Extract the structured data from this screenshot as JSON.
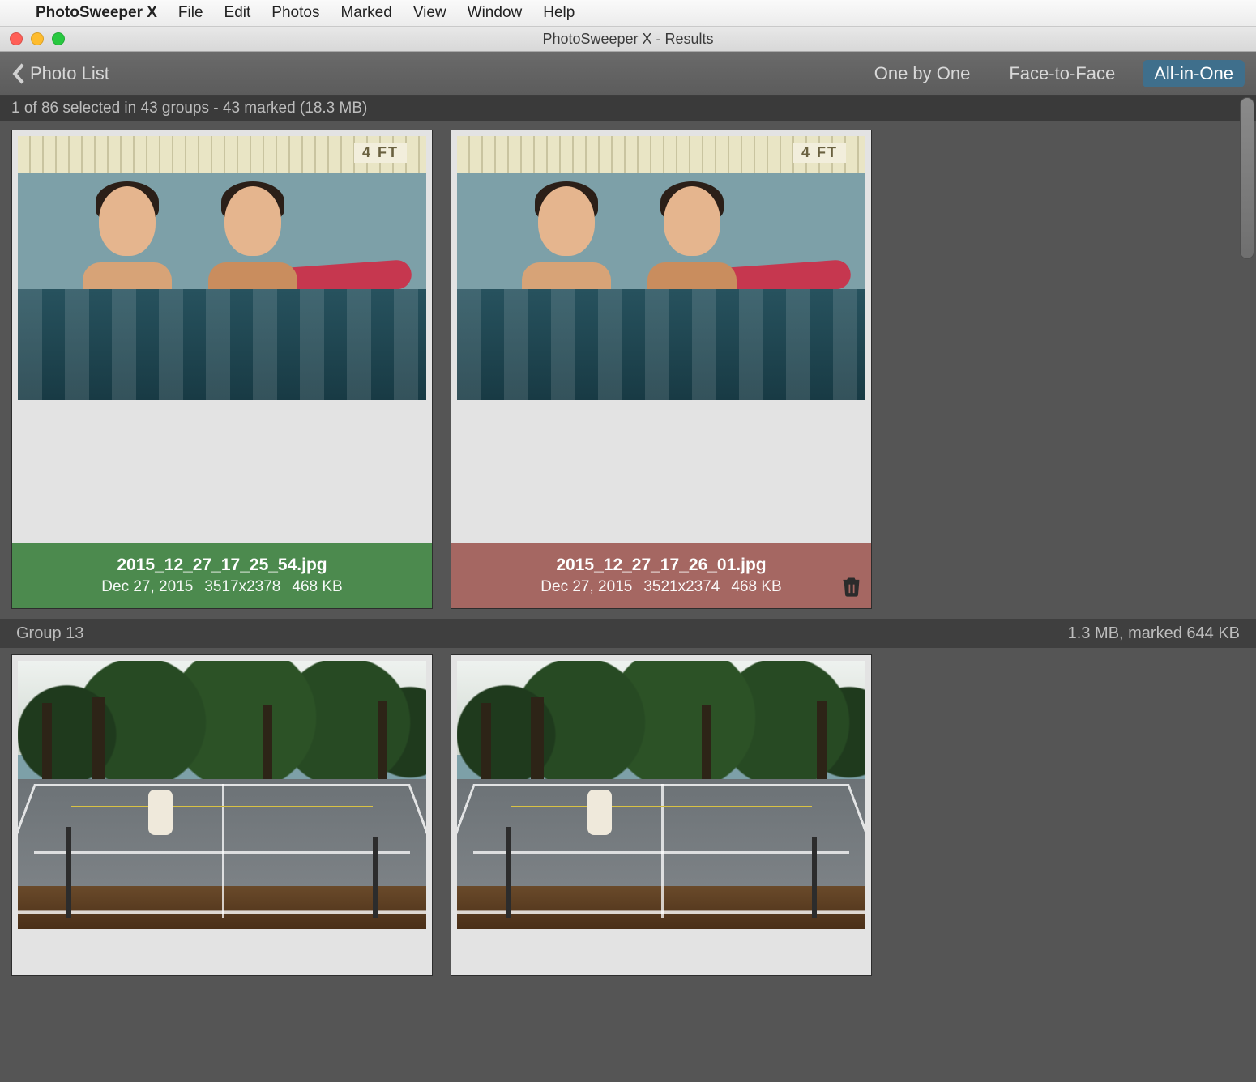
{
  "menubar": {
    "app": "PhotoSweeper X",
    "items": [
      "File",
      "Edit",
      "Photos",
      "Marked",
      "View",
      "Window",
      "Help"
    ]
  },
  "window": {
    "title": "PhotoSweeper X - Results"
  },
  "toolbar": {
    "back_label": "Photo List",
    "viewmodes": [
      "One by One",
      "Face-to-Face",
      "All-in-One"
    ],
    "active_index": 2
  },
  "status": {
    "text": "1 of 86 selected in 43 groups - 43 marked (18.3 MB)"
  },
  "groups": [
    {
      "header_left": "",
      "header_right": "",
      "cards": [
        {
          "scene": "pool",
          "depth_marker": "4 FT",
          "filename": "2015_12_27_17_25_54.jpg",
          "date": "Dec 27, 2015",
          "dims": "3517x2378",
          "size": "468 KB",
          "footer_style": "green",
          "marked": false
        },
        {
          "scene": "pool",
          "depth_marker": "4 FT",
          "filename": "2015_12_27_17_26_01.jpg",
          "date": "Dec 27, 2015",
          "dims": "3521x2374",
          "size": "468 KB",
          "footer_style": "red",
          "marked": true
        }
      ]
    },
    {
      "header_left": "Group 13",
      "header_right": "1.3 MB, marked 644 KB",
      "cards": [
        {
          "scene": "court",
          "filename": "",
          "date": "",
          "dims": "",
          "size": "",
          "footer_style": "",
          "marked": false
        },
        {
          "scene": "court",
          "filename": "",
          "date": "",
          "dims": "",
          "size": "",
          "footer_style": "",
          "marked": false
        }
      ]
    }
  ]
}
